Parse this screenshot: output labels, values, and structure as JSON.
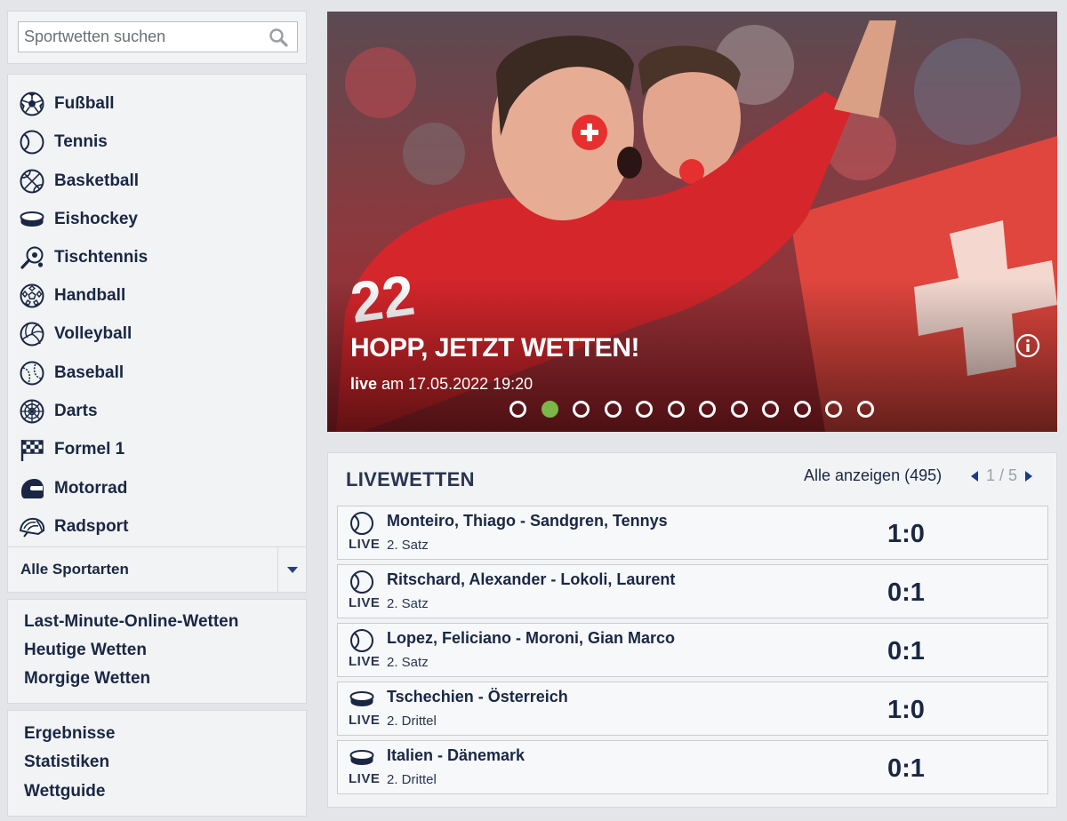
{
  "search": {
    "placeholder": "Sportwetten suchen",
    "icon": "magnifier-icon"
  },
  "sports": [
    {
      "label": "Fußball",
      "icon": "soccer-ball-icon"
    },
    {
      "label": "Tennis",
      "icon": "tennis-ball-icon"
    },
    {
      "label": "Basketball",
      "icon": "basketball-icon"
    },
    {
      "label": "Eishockey",
      "icon": "hockey-puck-icon"
    },
    {
      "label": "Tischtennis",
      "icon": "table-tennis-paddle-icon"
    },
    {
      "label": "Handball",
      "icon": "handball-icon"
    },
    {
      "label": "Volleyball",
      "icon": "volleyball-icon"
    },
    {
      "label": "Baseball",
      "icon": "baseball-icon"
    },
    {
      "label": "Darts",
      "icon": "dartboard-icon"
    },
    {
      "label": "Formel 1",
      "icon": "checkered-flag-icon"
    },
    {
      "label": "Motorrad",
      "icon": "motorcycle-helmet-icon"
    },
    {
      "label": "Radsport",
      "icon": "bicycle-helmet-icon"
    }
  ],
  "all_sports": {
    "label": "Alle Sportarten"
  },
  "quick_links": [
    "Last-Minute-Online-Wetten",
    "Heutige Wetten",
    "Morgige Wetten"
  ],
  "result_links": [
    "Ergebnisse",
    "Statistiken",
    "Wettguide"
  ],
  "hero": {
    "title": "HOPP, JETZT WETTEN!",
    "live_word": "live",
    "date_text": " am 17.05.2022 19:20",
    "slide_count": 12,
    "active_slide": 2
  },
  "live": {
    "title": "LIVEWETTEN",
    "show_all": "Alle anzeigen (495)",
    "page": "1 / 5",
    "live_tag": "LIVE",
    "matches": [
      {
        "teams": "Monteiro, Thiago - Sandgren, Tennys",
        "period": "2. Satz",
        "score": "1:0",
        "icon": "tennis-ball-icon"
      },
      {
        "teams": "Ritschard, Alexander - Lokoli, Laurent",
        "period": "2. Satz",
        "score": "0:1",
        "icon": "tennis-ball-icon"
      },
      {
        "teams": "Lopez, Feliciano - Moroni, Gian Marco",
        "period": "2. Satz",
        "score": "0:1",
        "icon": "tennis-ball-icon"
      },
      {
        "teams": "Tschechien - Österreich",
        "period": "2. Drittel",
        "score": "1:0",
        "icon": "hockey-puck-icon"
      },
      {
        "teams": "Italien - Dänemark",
        "period": "2. Drittel",
        "score": "0:1",
        "icon": "hockey-puck-icon"
      }
    ]
  },
  "colors": {
    "navy": "#1a2744",
    "accent_green": "#7ab648",
    "panel_bg": "#f2f3f4",
    "page_bg": "#e3e5e8"
  }
}
